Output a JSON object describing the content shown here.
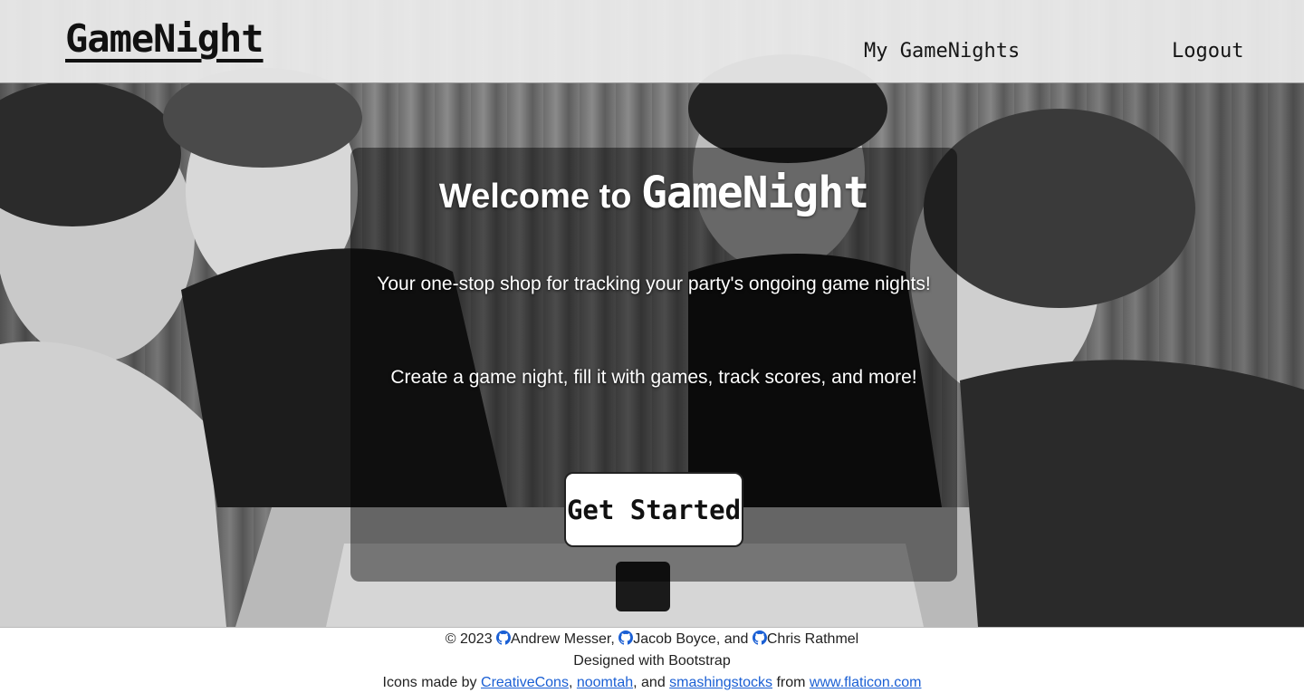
{
  "navbar": {
    "brand": "GameNight",
    "links": [
      "My GameNights",
      "Logout"
    ]
  },
  "hero": {
    "title_prefix": "Welcome to",
    "title_brand": "GameNight",
    "line1": "Your one-stop shop for tracking your party's ongoing game nights!",
    "line2": "Create a game night, fill it with games, track scores, and more!",
    "cta_label": "Get Started"
  },
  "footer": {
    "copyright": "© 2023",
    "authors": [
      "Andrew Messer,",
      "Jacob Boyce, and",
      "Chris Rathmel"
    ],
    "designed_with": "Designed with Bootstrap",
    "icons_prefix": "Icons made by",
    "icon_authors": [
      "CreativeCons",
      "noomtah",
      "smashingstocks"
    ],
    "sep1": ",",
    "sep2": ", and",
    "from_text": "from",
    "source_link": "www.flaticon.com"
  },
  "colors": {
    "link": "#1a5fd4",
    "github_icon": "#1a5fd4"
  }
}
